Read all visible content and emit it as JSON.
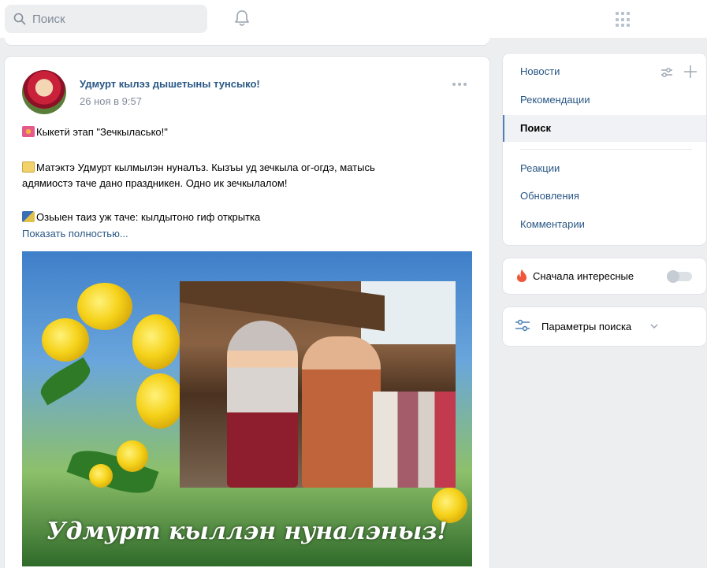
{
  "header": {
    "search_placeholder": "Поиск",
    "icons": [
      "search-icon",
      "bell-icon",
      "apps-grid-icon"
    ]
  },
  "post": {
    "author": "Удмурт кылэз дышетыны тунсыко!",
    "date": "26 ноя в 9:57",
    "line1": "Кыкетӥ этап \"Зечкыласько!\"",
    "line2": "Матэктэ Удмурт кылмылэн нуналъз. Кызъы уд зечкыла ог-огдэ, матысь",
    "line3": "адямиостэ таче дано праздникен. Одно ик зечкылалом!",
    "line4": "Озьыен таиз уж таче: кылдытоно гиф открытка",
    "show_more": "Показать полностью...",
    "image_caption": "Удмурт кыллэн нуналэныз!"
  },
  "menu": {
    "items": [
      {
        "label": "Новости"
      },
      {
        "label": "Рекомендации"
      },
      {
        "label": "Поиск"
      },
      {
        "label": "Реакции"
      },
      {
        "label": "Обновления"
      },
      {
        "label": "Комментарии"
      }
    ],
    "active": "Поиск"
  },
  "interest": {
    "label": "Сначала интересные",
    "enabled": false
  },
  "search_params": {
    "label": "Параметры поиска"
  },
  "colors": {
    "link": "#2a5885",
    "background": "#edeef0",
    "accent": "#5181b8"
  }
}
